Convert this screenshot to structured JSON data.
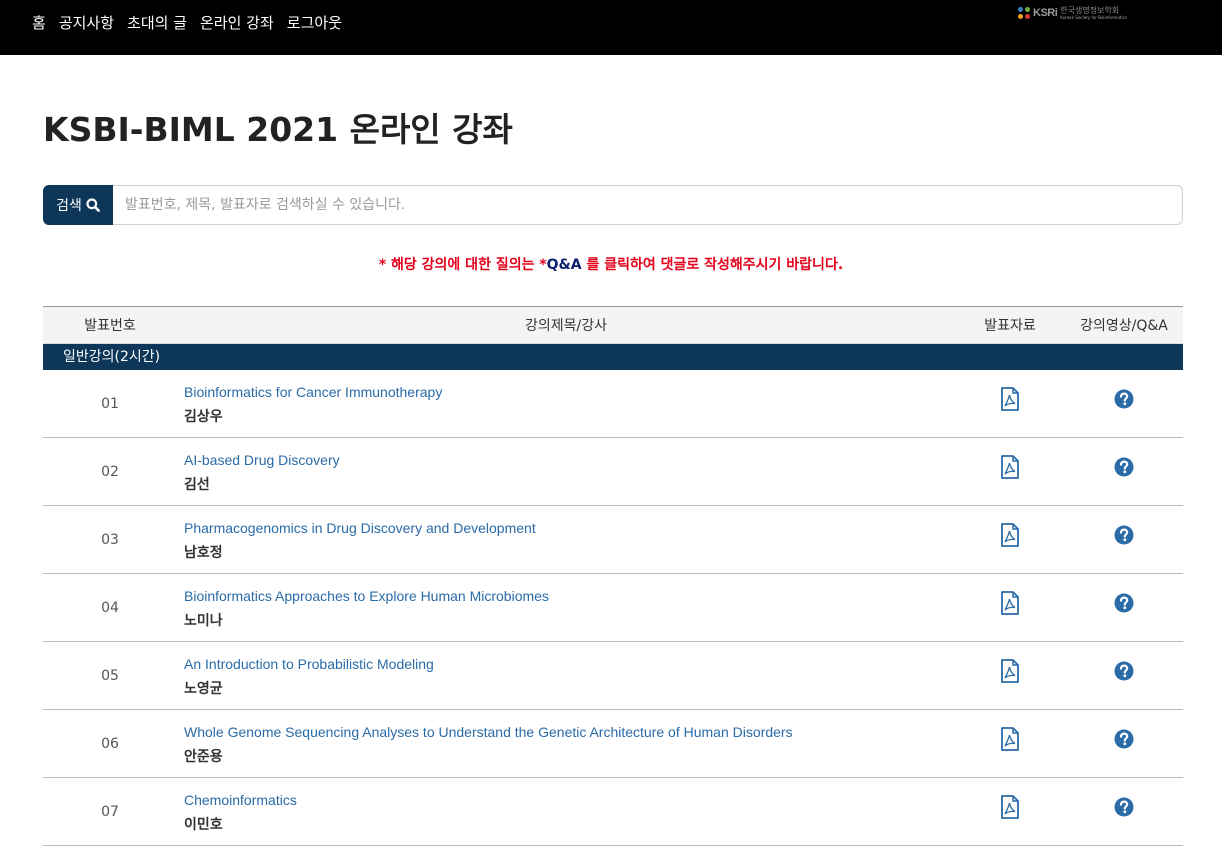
{
  "nav": {
    "items": [
      "홈",
      "공지사항",
      "초대의 글",
      "온라인 강좌",
      "로그아웃"
    ],
    "logo_mark": "KSRi",
    "logo_kr": "한국생명정보학회",
    "logo_en": "Korean Society for Bioinformatics"
  },
  "page": {
    "title": "KSBI-BIML 2021 온라인 강좌"
  },
  "search": {
    "button_label": "검색",
    "button_icon": "search-icon",
    "placeholder": "발표번호, 제목, 발표자로 검색하실 수 있습니다."
  },
  "notice": {
    "prefix": "* 해당 강의에 대한 질의는 *",
    "qa": "Q&A",
    "suffix": " 를 클릭하여 댓글로 작성해주시기 바랍니다."
  },
  "table": {
    "headers": {
      "num": "발표번호",
      "title": "강의제목/강사",
      "pdf": "발표자료",
      "qa": "강의영상/Q&A"
    },
    "section": "일반강의(2시간)",
    "rows": [
      {
        "num": "01",
        "title": "Bioinformatics for Cancer Immunotherapy",
        "speaker": "김상우"
      },
      {
        "num": "02",
        "title": "AI-based Drug Discovery",
        "speaker": "김선"
      },
      {
        "num": "03",
        "title": "Pharmacogenomics in Drug Discovery and Development",
        "speaker": "남호정"
      },
      {
        "num": "04",
        "title": "Bioinformatics Approaches to Explore Human Microbiomes",
        "speaker": "노미나"
      },
      {
        "num": "05",
        "title": "An Introduction to Probabilistic Modeling",
        "speaker": "노영균"
      },
      {
        "num": "06",
        "title": "Whole Genome Sequencing Analyses to Understand the Genetic Architecture of Human Disorders",
        "speaker": "안준용"
      },
      {
        "num": "07",
        "title": "Chemoinformatics",
        "speaker": "이민호"
      }
    ]
  },
  "colors": {
    "nav_bg": "#000000",
    "primary": "#0d3658",
    "link": "#2a6ba8",
    "notice": "#e4001b",
    "qa_text": "#0d1f6e"
  },
  "icons": {
    "pdf": "pdf-file-icon",
    "qa": "question-circle-icon"
  }
}
